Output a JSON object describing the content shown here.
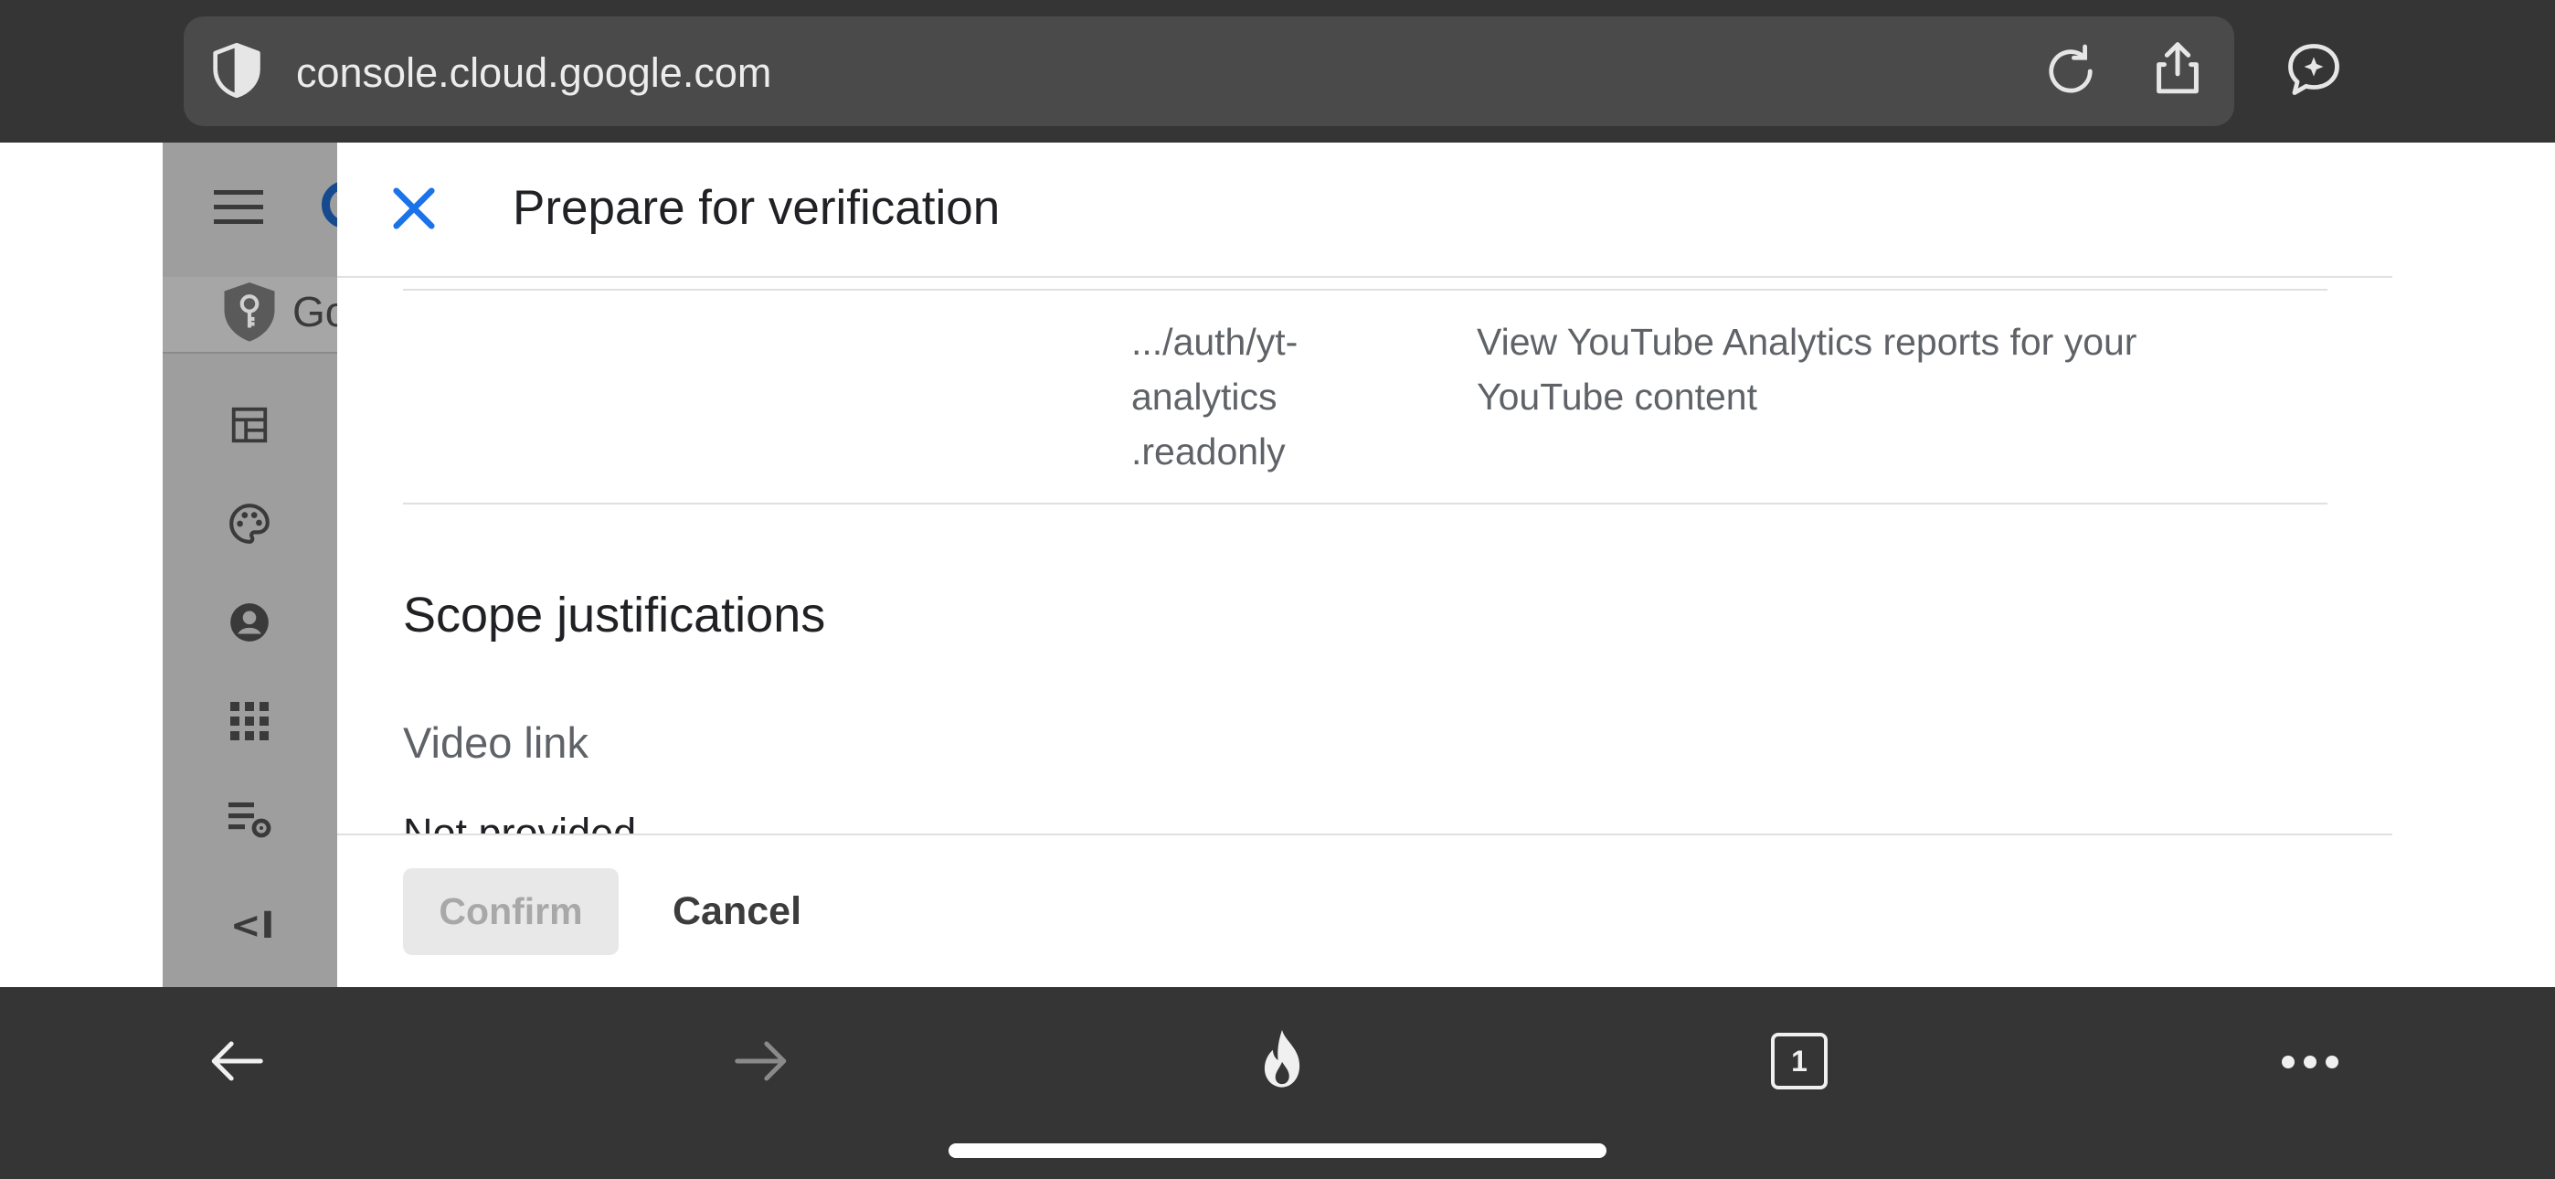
{
  "browser": {
    "url": "console.cloud.google.com",
    "tab_count": "1"
  },
  "sidebar": {
    "partial_title": "Go"
  },
  "dialog": {
    "title": "Prepare for verification",
    "scope_row": {
      "scope_line1": ".../auth/yt-",
      "scope_line2": "analytics",
      "scope_line3": ".readonly",
      "description_line1": "View YouTube Analytics reports for your",
      "description_line2": "YouTube content"
    },
    "section_title": "Scope justifications",
    "video_link_label": "Video link",
    "video_link_value": "Not provided",
    "confirm_label": "Confirm",
    "cancel_label": "Cancel"
  },
  "colors": {
    "accent": "#1a73e8",
    "browser_chrome": "#353535",
    "scrim": "#9e9e9e"
  }
}
